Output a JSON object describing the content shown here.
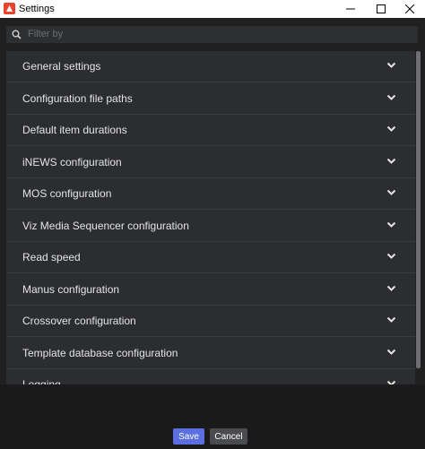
{
  "window": {
    "title": "Settings",
    "icons": {
      "app": "app-logo-icon",
      "minimize": "minimize-icon",
      "maximize": "maximize-icon",
      "close": "close-icon"
    }
  },
  "filter": {
    "placeholder": "Filter by",
    "value": "",
    "icon": "search-icon"
  },
  "sections": [
    {
      "label": "General settings"
    },
    {
      "label": "Configuration file paths"
    },
    {
      "label": "Default item durations"
    },
    {
      "label": "iNEWS configuration"
    },
    {
      "label": "MOS configuration"
    },
    {
      "label": "Viz Media Sequencer configuration"
    },
    {
      "label": "Read speed"
    },
    {
      "label": "Manus configuration"
    },
    {
      "label": "Crossover configuration"
    },
    {
      "label": "Template database configuration"
    },
    {
      "label": "Logging"
    }
  ],
  "footer": {
    "save_label": "Save",
    "cancel_label": "Cancel"
  },
  "colors": {
    "accent": "#5b6fe0",
    "app_icon": "#e8452c",
    "row_bg": "#2b2d30",
    "background": "#202020"
  }
}
